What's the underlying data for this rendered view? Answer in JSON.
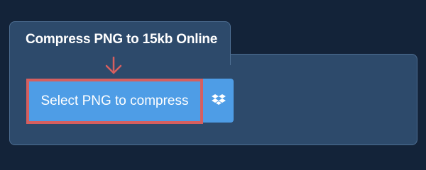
{
  "tool": {
    "title": "Compress PNG to 15kb Online",
    "select_button_label": "Select PNG to compress",
    "dropbox_icon": "dropbox-icon",
    "pointer_icon": "arrow-down-icon"
  },
  "colors": {
    "page_background": "#132339",
    "panel_background": "#2d4a6b",
    "panel_border": "#4d6d91",
    "button_background": "#4e9de6",
    "highlight_border": "#d65f5f",
    "text": "#ffffff"
  }
}
